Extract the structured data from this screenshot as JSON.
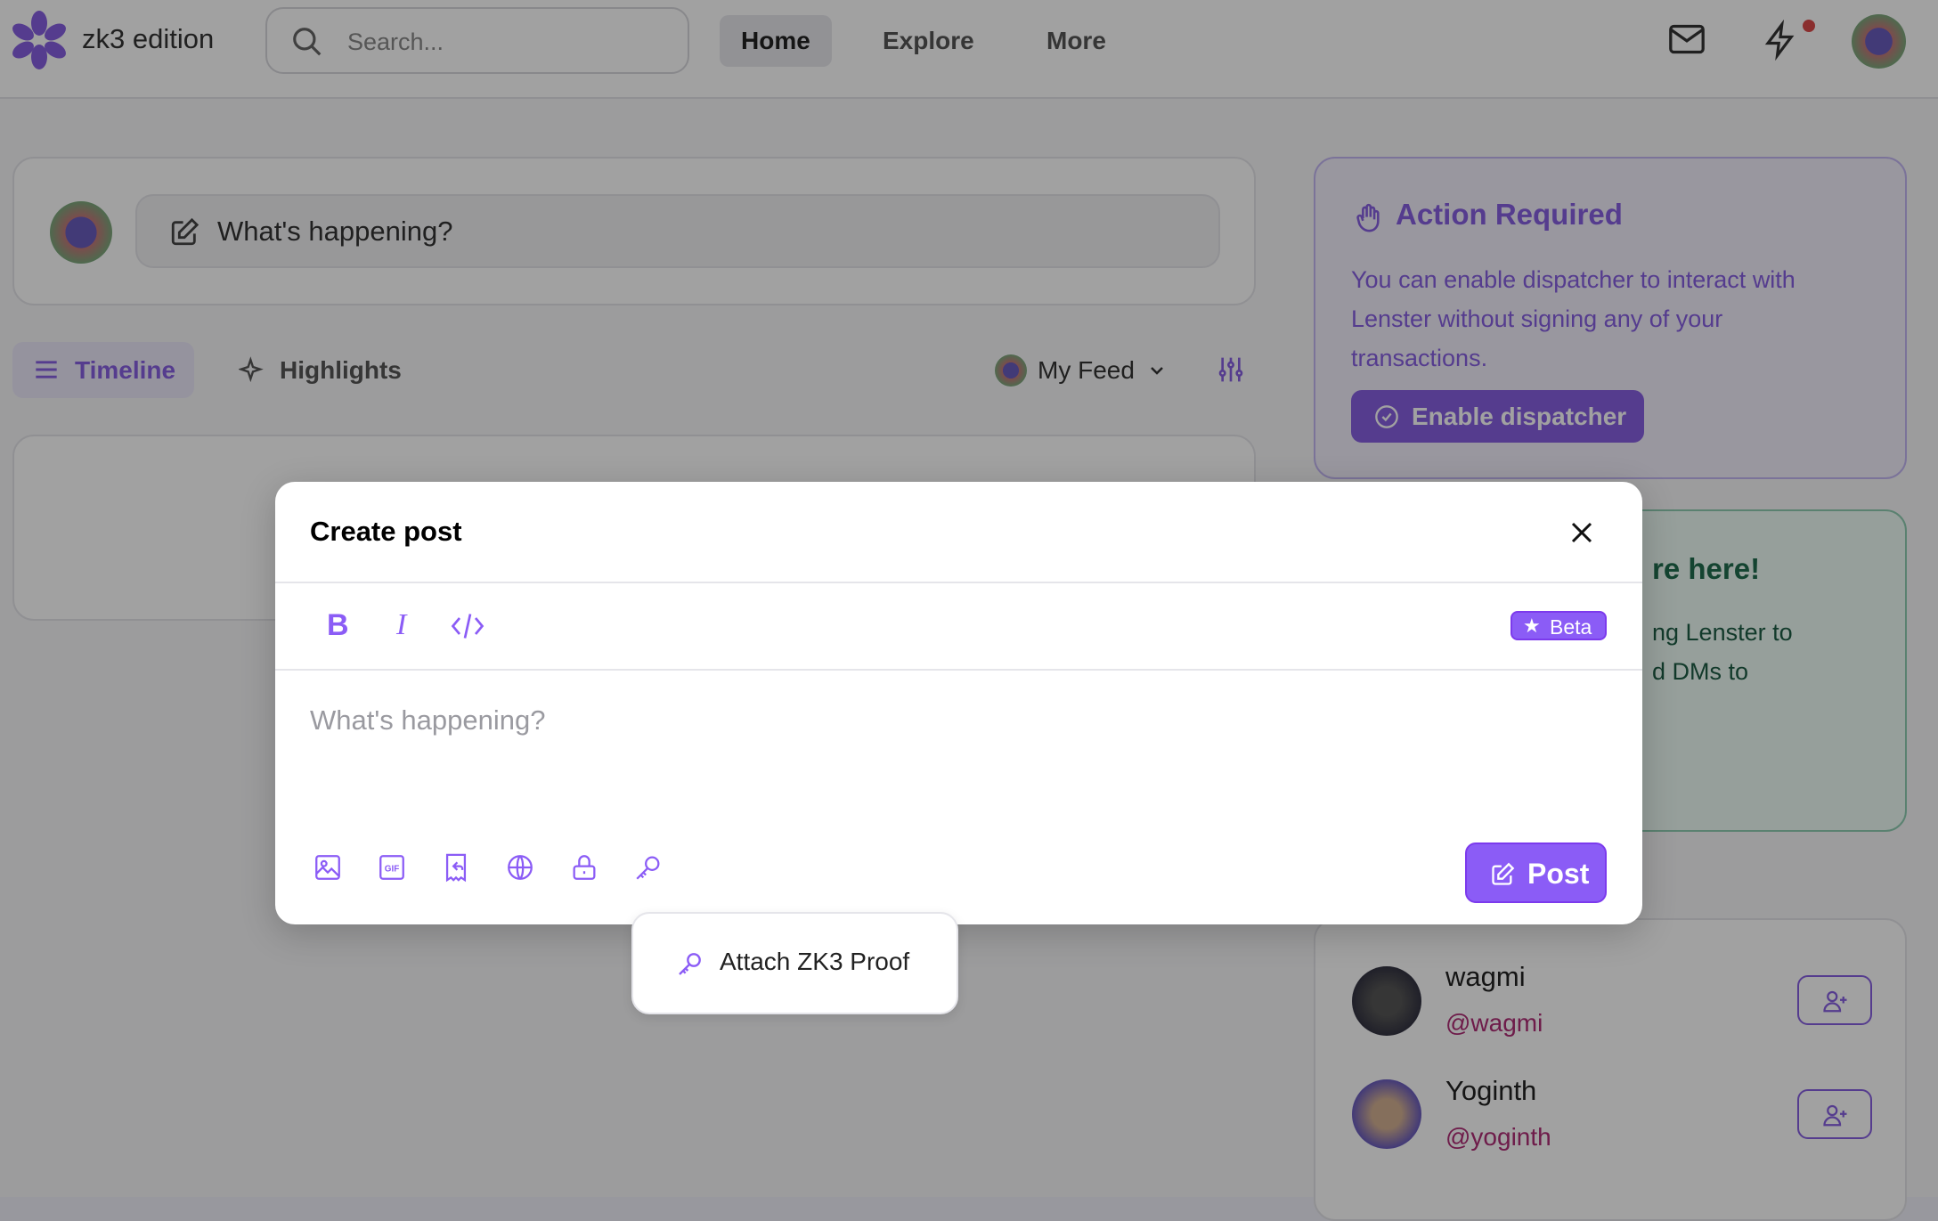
{
  "header": {
    "logo_text": "zk3 edition",
    "search_placeholder": "Search...",
    "nav": [
      "Home",
      "Explore",
      "More"
    ]
  },
  "composer": {
    "placeholder": "What's happening?"
  },
  "tabs": {
    "timeline": "Timeline",
    "highlights": "Highlights",
    "feed_select": "My Feed"
  },
  "action_card": {
    "title": "Action Required",
    "body": [
      "You can enable dispatcher to interact with",
      "Lenster without signing any of your",
      "transactions."
    ],
    "button": "Enable dispatcher"
  },
  "promo_card": {
    "title_partial": "re here!",
    "lines": [
      "ng Lenster to",
      "d DMs to"
    ]
  },
  "follow": [
    {
      "name": "wagmi",
      "handle": "@wagmi"
    },
    {
      "name": "Yoginth",
      "handle": "@yoginth"
    }
  ],
  "modal": {
    "title": "Create post",
    "beta": "Beta",
    "placeholder": "What's happening?",
    "post_button": "Post",
    "toolbar": [
      "bold",
      "italic",
      "code"
    ],
    "attach_icons": [
      "image-icon",
      "gif-icon",
      "collect-icon",
      "globe-icon",
      "lock-icon",
      "key-icon"
    ]
  },
  "dropdown": {
    "item": "Attach ZK3 Proof"
  },
  "colors": {
    "accent": "#8b5cf6",
    "notification": "#ef4444"
  }
}
